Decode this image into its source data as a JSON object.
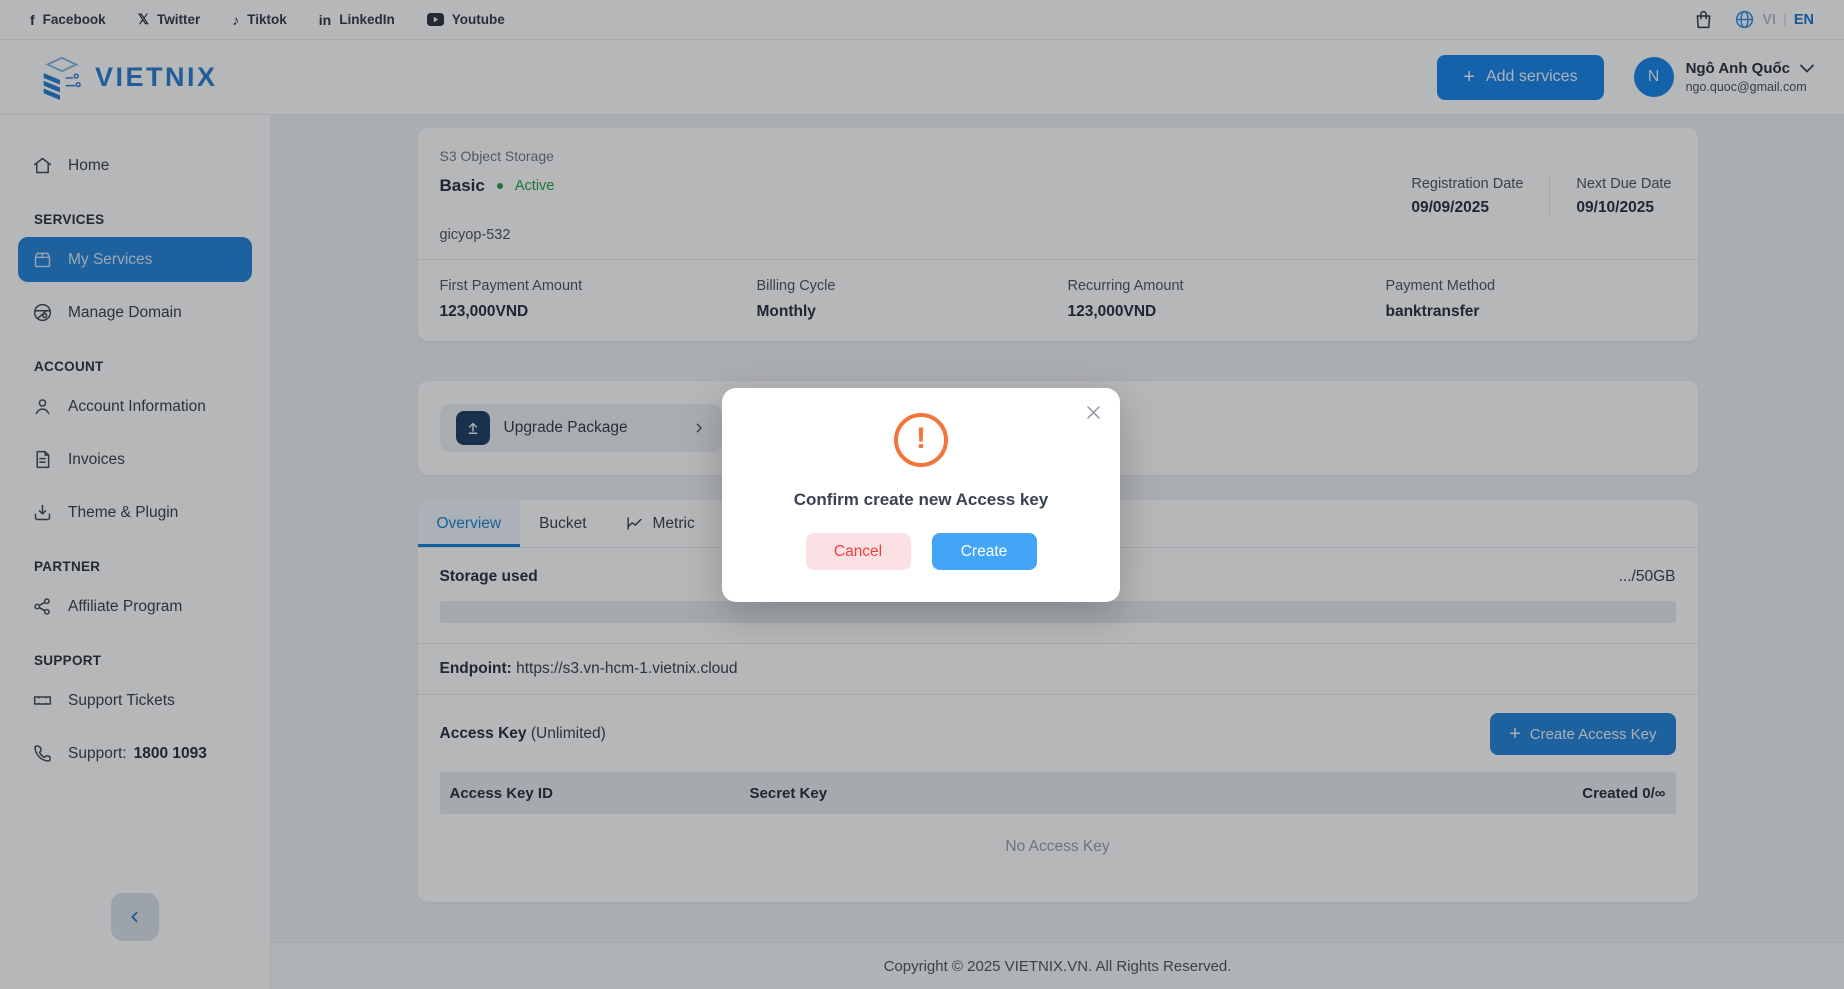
{
  "topbar": {
    "social": [
      {
        "label": "Facebook"
      },
      {
        "label": "Twitter"
      },
      {
        "label": "Tiktok"
      },
      {
        "label": "LinkedIn"
      },
      {
        "label": "Youtube"
      }
    ],
    "lang_vi": "VI",
    "lang_sep": "|",
    "lang_en": "EN"
  },
  "header": {
    "brand": "VIETNIX",
    "add_services_label": "Add services",
    "plus": "+",
    "user": {
      "initial": "N",
      "name": "Ngô Anh Quốc",
      "email": "ngo.quoc@gmail.com"
    }
  },
  "sidebar": {
    "items": {
      "home": "Home",
      "my_services": "My Services",
      "manage_domain": "Manage Domain",
      "account_information": "Account Information",
      "invoices": "Invoices",
      "theme_plugin": "Theme & Plugin",
      "affiliate_program": "Affiliate Program",
      "support_tickets": "Support Tickets"
    },
    "headings": {
      "services": "SERVICES",
      "account": "ACCOUNT",
      "partner": "PARTNER",
      "support": "SUPPORT"
    },
    "support_phone_label": "Support:",
    "support_phone": "1800 1093"
  },
  "service_card": {
    "type": "S3 Object Storage",
    "plan": "Basic",
    "status": "Active",
    "service_id": "gicyop-532",
    "registration": {
      "label": "Registration Date",
      "value": "09/09/2025"
    },
    "next_due": {
      "label": "Next Due Date",
      "value": "09/10/2025"
    },
    "payments": {
      "first_payment": {
        "label": "First Payment Amount",
        "value": "123,000VND"
      },
      "billing_cycle": {
        "label": "Billing Cycle",
        "value": "Monthly"
      },
      "recurring": {
        "label": "Recurring Amount",
        "value": "123,000VND"
      },
      "method": {
        "label": "Payment Method",
        "value": "banktransfer"
      }
    }
  },
  "upgrade": {
    "label": "Upgrade Package"
  },
  "tabs": {
    "overview": "Overview",
    "bucket": "Bucket",
    "metric": "Metric"
  },
  "overview": {
    "storage_label": "Storage used",
    "storage_value": ".../50GB",
    "endpoint_label": "Endpoint:",
    "endpoint_url": "https://s3.vn-hcm-1.vietnix.cloud",
    "access_key_label": "Access Key",
    "access_key_limit": "(Unlimited)",
    "create_key_label": "Create Access Key",
    "plus": "+",
    "table": {
      "col_access_key_id": "Access Key ID",
      "col_secret_key": "Secret Key",
      "col_created": "Created 0/∞",
      "empty": "No Access Key"
    }
  },
  "footer": {
    "copyright": "Copyright © 2025 VIETNIX.VN. All Rights Reserved."
  },
  "modal": {
    "title": "Confirm create new Access key",
    "cancel_label": "Cancel",
    "create_label": "Create"
  },
  "colors": {
    "brand_blue": "#2584db",
    "bright_blue": "#42a5f5",
    "status_green": "#27a348",
    "warn_orange": "#f4743c",
    "cancel_red": "#f03e3e",
    "lang_active_blue": "#1a73cf"
  }
}
